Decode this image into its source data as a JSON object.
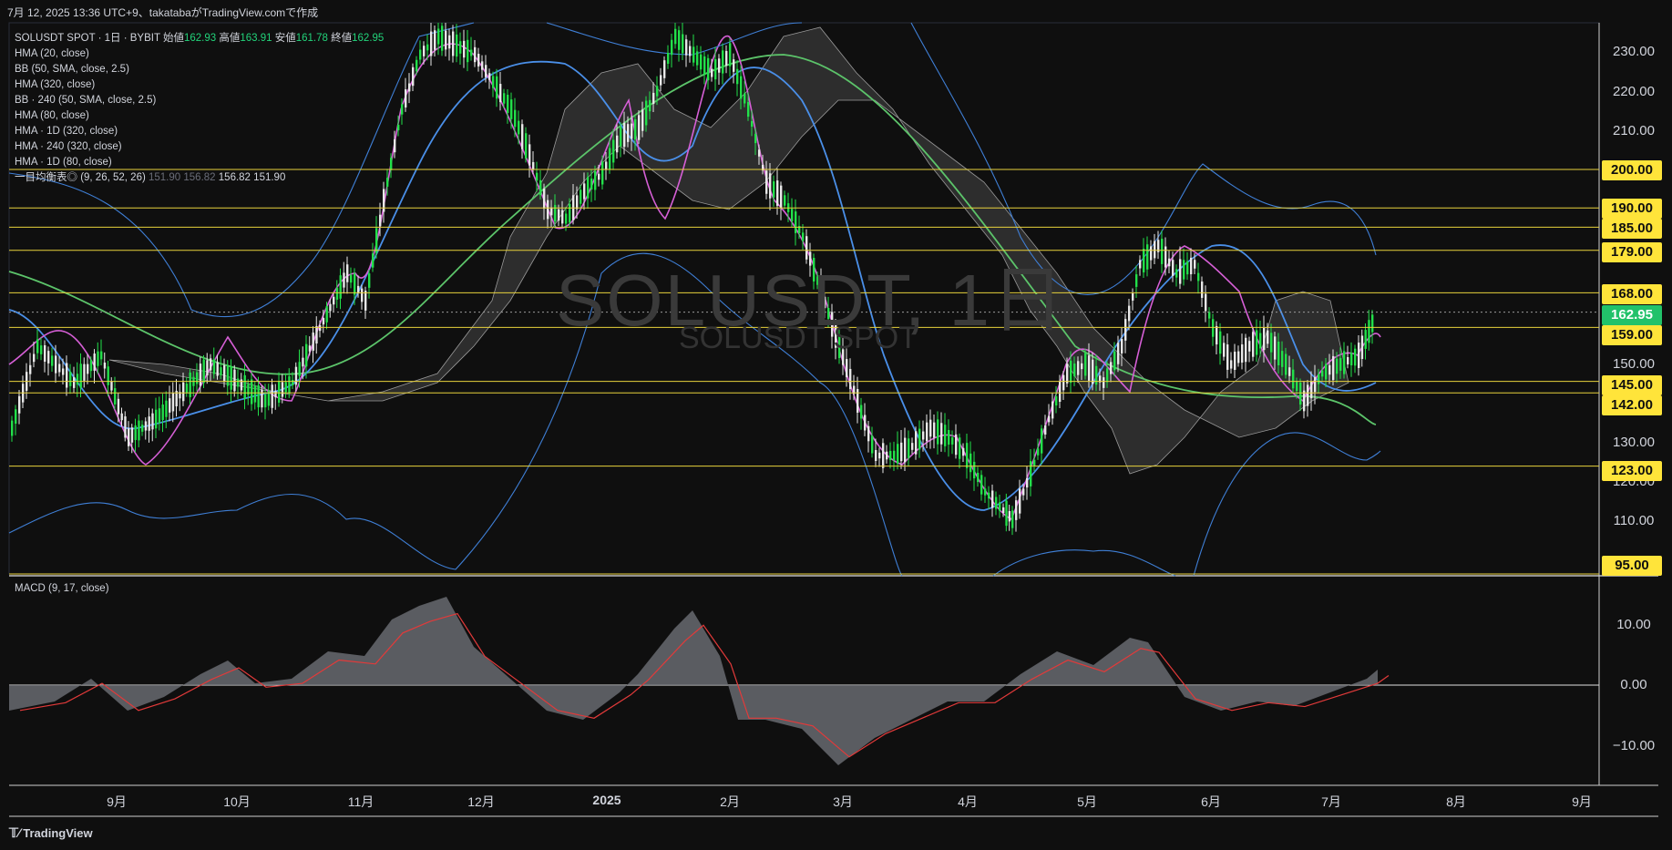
{
  "caption": "7月 12, 2025 13:36 UTC+9、takatabaがTradingView.comで作成",
  "symbol_line": {
    "symbol": "SOLUSDT SPOT · 1日 · BYBIT",
    "open_label": "始値",
    "open": "162.93",
    "high_label": "高値",
    "high": "163.91",
    "low_label": "安値",
    "low": "161.78",
    "close_label": "終値",
    "close": "162.95"
  },
  "indicators": [
    "HMA (20, close)",
    "BB (50, SMA, close, 2.5)",
    "HMA (320, close)",
    "BB · 240 (50, SMA, close, 2.5)",
    "HMA (80, close)",
    "HMA · 1D (320, close)",
    "HMA · 240 (320, close)",
    "HMA · 1D (80, close)"
  ],
  "ichimoku": {
    "label": "一目均衡表◎ (9, 26, 52, 26)",
    "v1": "151.90",
    "v2": "156.82",
    "v3": "156.82",
    "v4": "151.90"
  },
  "watermark": {
    "main": "SOLUSDT, 1日",
    "sub": "SOLUSDT SPOT"
  },
  "price_axis_ticks": [
    "230.00",
    "220.00",
    "210.00",
    "150.00",
    "130.00",
    "120.00",
    "110.00"
  ],
  "horizontal_levels": [
    "200.00",
    "190.00",
    "185.00",
    "179.00",
    "168.00",
    "159.00",
    "145.00",
    "142.00",
    "123.00",
    "95.00"
  ],
  "current_price": "162.95",
  "macd": {
    "title": "MACD (9, 17, close)",
    "ticks": [
      "10.00",
      "0.00",
      "−10.00"
    ]
  },
  "time_axis": [
    {
      "label": "9月",
      "bold": false
    },
    {
      "label": "10月",
      "bold": false
    },
    {
      "label": "11月",
      "bold": false
    },
    {
      "label": "12月",
      "bold": false
    },
    {
      "label": "2025",
      "bold": true
    },
    {
      "label": "2月",
      "bold": false
    },
    {
      "label": "3月",
      "bold": false
    },
    {
      "label": "4月",
      "bold": false
    },
    {
      "label": "5月",
      "bold": false
    },
    {
      "label": "6月",
      "bold": false
    },
    {
      "label": "7月",
      "bold": false
    },
    {
      "label": "8月",
      "bold": false
    },
    {
      "label": "9月",
      "bold": false
    }
  ],
  "footer": "TradingView",
  "colors": {
    "background": "#0f0f0f",
    "level_line": "#e8d23c",
    "bull": "#22e04a",
    "bear": "#e8e8e8",
    "hma20": "#d65fd6",
    "hma80": "#4a8fe8",
    "hma320": "#5cc46a",
    "bb": "#3f7fd6",
    "cloud": "#3a3a3a",
    "macd_fill": "#6d6f76",
    "signal": "#e23a3a"
  }
}
